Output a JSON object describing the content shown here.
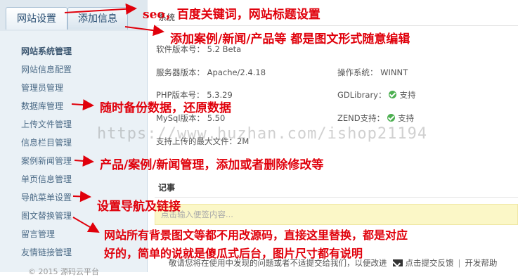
{
  "tabs": [
    {
      "label": "网站设置",
      "active": true
    },
    {
      "label": "添加信息",
      "active": false
    }
  ],
  "sidebar": {
    "title": "网站系统管理",
    "items": [
      "网站信息配置",
      "管理员管理",
      "数据库管理",
      "上传文件管理",
      "信息栏目管理",
      "案例新闻管理",
      "单页信息管理",
      "导航菜单设置",
      "图文替换管理",
      "留言管理",
      "友情链接管理"
    ],
    "footer": "© 2015 源码云平台"
  },
  "system": {
    "heading": "系统",
    "software_version": {
      "label": "软件版本号：",
      "value": "5.2 Beta"
    },
    "server_version": {
      "label": "服务器版本：",
      "value": "Apache/2.4.18"
    },
    "os": {
      "label": "操作系统：",
      "value": "WINNT"
    },
    "php_version": {
      "label": "PHP版本号：",
      "value": "5.3.29"
    },
    "gd": {
      "label": "GDLibrary：",
      "value": "支持"
    },
    "mysql_version": {
      "label": "MySql版本：",
      "value": "5.50"
    },
    "zend": {
      "label": "ZEND支持：",
      "value": "支持"
    },
    "upload_max": {
      "label": "支持上传的最大文件：",
      "value": "2M"
    }
  },
  "notes": {
    "heading": "记事",
    "placeholder": "点击输入便签内容..."
  },
  "footer": {
    "text": "敬请您将在使用中发现的问题或者不适提交给我们，以便改进",
    "feedback_link": "点击提交反馈",
    "help_link": "开发帮助"
  },
  "watermark": "https://www.huzhan.com/ishop21194",
  "annotations": [
    "seo，百度关键词，网站标题设置",
    "添加案例/新闻/产品等 都是图文形式随意编辑",
    "随时备份数据，还原数据",
    "产品/案例/新闻管理，添加或者删除修改等",
    "设置导航及链接",
    "网站所有背景图文等都不用改源码，直接这里替换，都是对应",
    "好的，简单的说就是傻瓜式后台，图片尺寸都有说明"
  ],
  "colors": {
    "annotation_red": "#e0000b",
    "sidebar_bg": "#eaf1f6",
    "notes_bg": "#fbf7c7",
    "ok_green": "#4caf50"
  }
}
